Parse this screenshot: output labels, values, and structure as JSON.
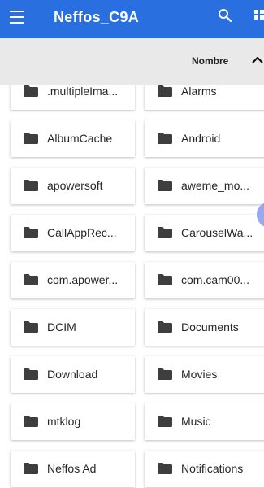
{
  "app_bar": {
    "title": "Neffos_C9A",
    "color": "#2a6fe0"
  },
  "sort_bar": {
    "label": "Nombre"
  },
  "folders": [
    {
      "name": ".multipleIma..."
    },
    {
      "name": "Alarms"
    },
    {
      "name": "AlbumCache"
    },
    {
      "name": "Android"
    },
    {
      "name": "apowersoft"
    },
    {
      "name": "aweme_mo..."
    },
    {
      "name": "CallAppRec..."
    },
    {
      "name": "CarouselWa..."
    },
    {
      "name": "com.apower..."
    },
    {
      "name": "com.cam00..."
    },
    {
      "name": "DCIM"
    },
    {
      "name": "Documents"
    },
    {
      "name": "Download"
    },
    {
      "name": "Movies"
    },
    {
      "name": "mtklog"
    },
    {
      "name": "Music"
    },
    {
      "name": "Neffos Ad"
    },
    {
      "name": "Notifications"
    }
  ]
}
